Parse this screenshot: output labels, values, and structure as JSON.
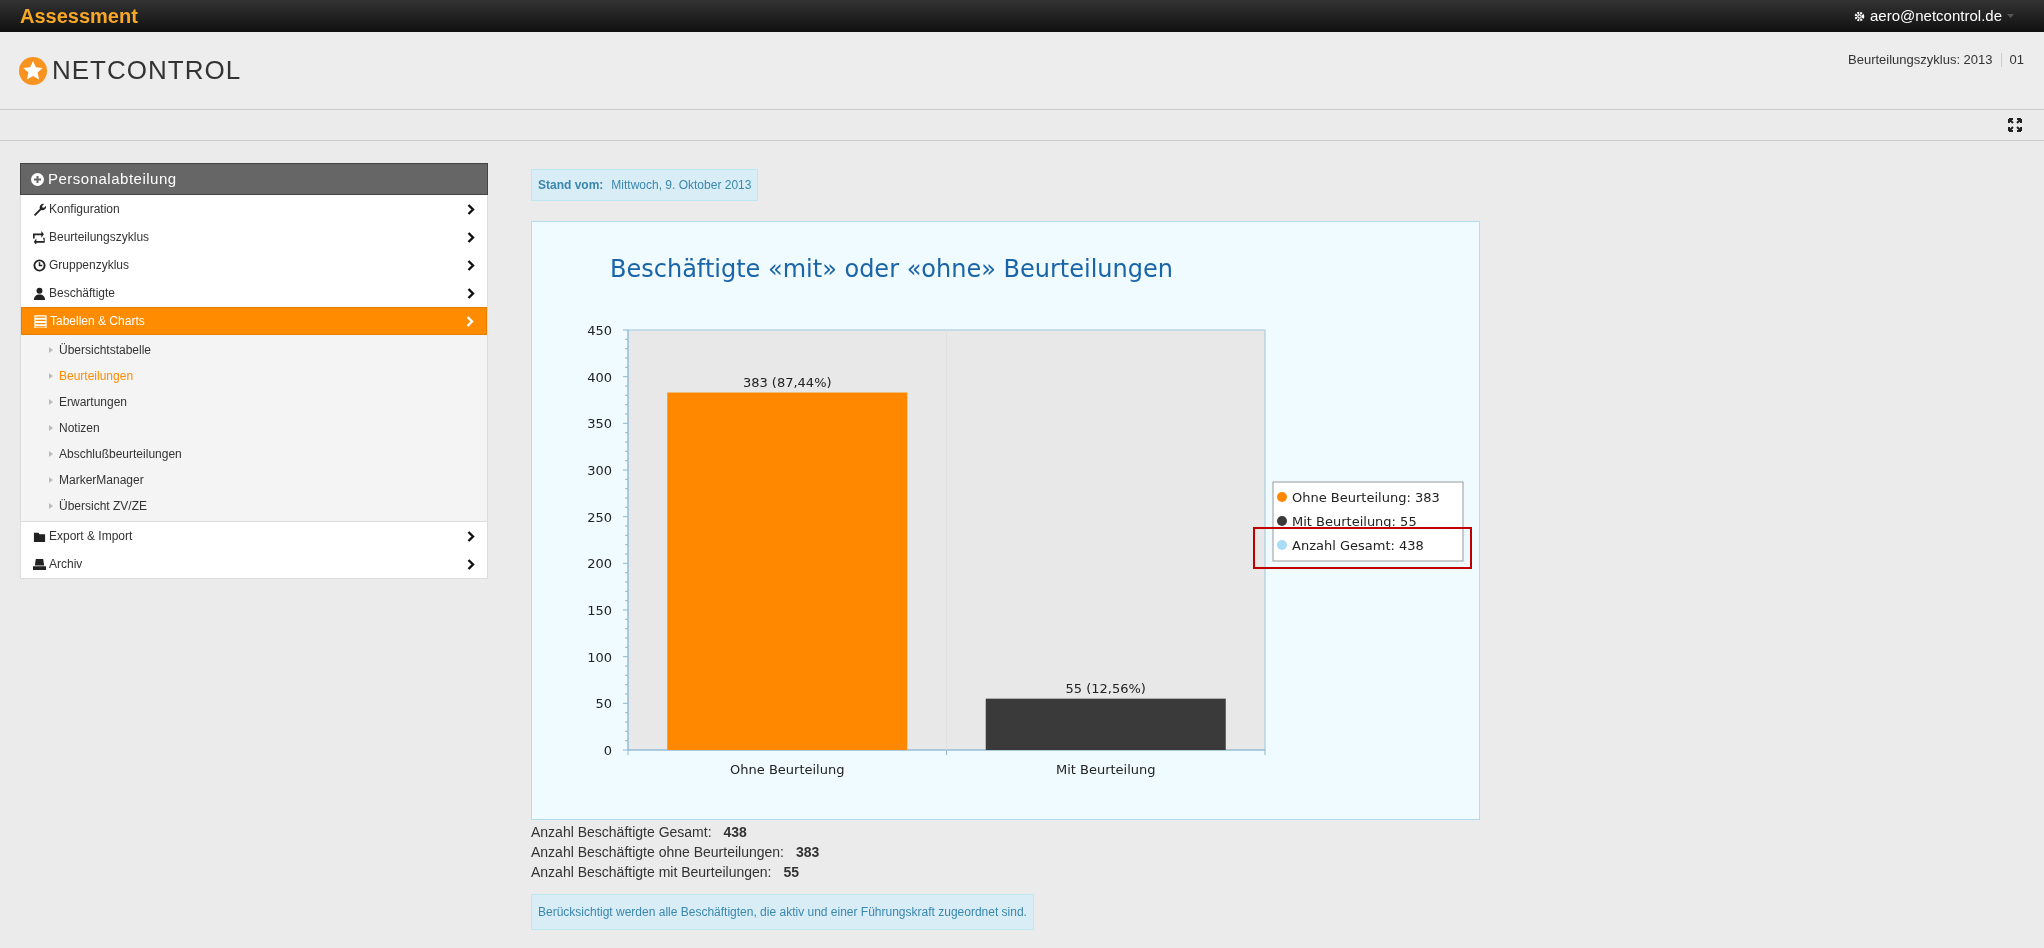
{
  "topbar": {
    "app_title": "Assessment",
    "user": "aero@netcontrol.de"
  },
  "header": {
    "logo": "NETCONTROL",
    "cycle": "Beurteilungszyklus: 2013",
    "cycle_number": "01"
  },
  "sidebar": {
    "title": "Personalabteilung",
    "items": [
      {
        "label": "Konfiguration",
        "selected": false
      },
      {
        "label": "Beurteilungszyklus",
        "selected": false
      },
      {
        "label": "Gruppenzyklus",
        "selected": false
      },
      {
        "label": "Beschäftigte",
        "selected": false
      },
      {
        "label": "Tabellen & Charts",
        "selected": true,
        "children": [
          {
            "label": "Übersichtstabelle",
            "selected": false
          },
          {
            "label": "Beurteilungen",
            "selected": true
          },
          {
            "label": "Erwartungen",
            "selected": false
          },
          {
            "label": "Notizen",
            "selected": false
          },
          {
            "label": "Abschlußbeurteilungen",
            "selected": false
          },
          {
            "label": "MarkerManager",
            "selected": false
          },
          {
            "label": "Übersicht ZV/ZE",
            "selected": false
          }
        ]
      },
      {
        "label": "Export & Import",
        "selected": false
      },
      {
        "label": "Archiv",
        "selected": false
      }
    ]
  },
  "stand": {
    "label": "Stand vom:",
    "date": "Mittwoch, 9. Oktober 2013"
  },
  "chart": {
    "chart_data": {
      "type": "bar",
      "title": "Beschäftigte «mit» oder «ohne» Beurteilungen",
      "categories": [
        "Ohne Beurteilung",
        "Mit Beurteilung"
      ],
      "values": [
        383,
        55
      ],
      "ylim": [
        0,
        450
      ],
      "yticks": [
        0,
        50,
        100,
        150,
        200,
        250,
        300,
        350,
        400,
        450
      ],
      "value_labels": [
        "383 (87,44%)",
        "55 (12,56%)"
      ]
    },
    "legend": [
      {
        "label": "Ohne Beurteilung: 383",
        "color": "#ff8800",
        "highlighted": false
      },
      {
        "label": "Mit Beurteilung: 55",
        "color": "#3a3a3a",
        "highlighted": false
      },
      {
        "label": "Anzahl Gesamt: 438",
        "color": "#a9dcf5",
        "highlighted": true
      }
    ]
  },
  "summary": [
    {
      "label": "Anzahl Beschäftigte Gesamt:",
      "value": "438"
    },
    {
      "label": "Anzahl Beschäftigte ohne Beurteilungen:",
      "value": "383"
    },
    {
      "label": "Anzahl Beschäftigte mit Beurteilungen:",
      "value": "55"
    }
  ],
  "note": "Berücksichtigt werden alle Beschäftigten, die aktiv und einer Führungskraft zugeordnet sind."
}
